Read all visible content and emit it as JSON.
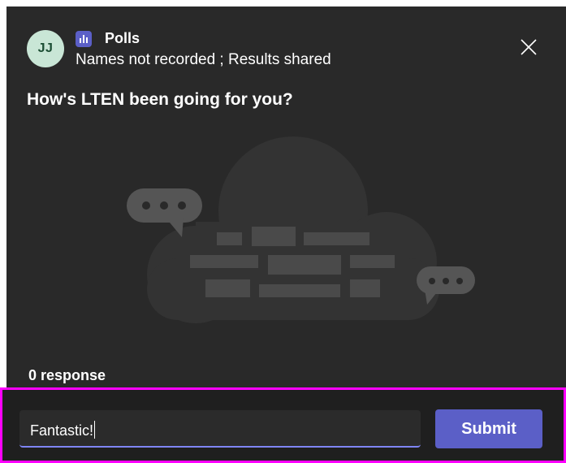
{
  "header": {
    "avatar_initials": "JJ",
    "app_icon": "poll-chart-icon",
    "app_name": "Polls",
    "subtitle": "Names not recorded ; Results shared",
    "close_icon": "close-icon"
  },
  "poll": {
    "question": "How's LTEN been going for you?",
    "response_count": "0 response",
    "illustration": "empty-poll-illustration"
  },
  "answer": {
    "value": "Fantastic!",
    "submit_label": "Submit"
  },
  "colors": {
    "dialog_bg": "#292929",
    "accent": "#5b5fc7",
    "highlight": "#ff00ff"
  }
}
